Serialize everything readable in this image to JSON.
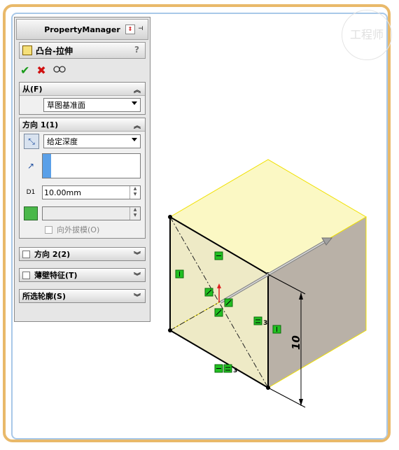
{
  "watermark": "工程师",
  "pm": {
    "header_title": "PropertyManager",
    "feature_title": "凸台-拉伸",
    "help": "?",
    "actions": {
      "ok": "✔",
      "cancel": "✖",
      "preview": "6਼"
    },
    "from": {
      "title": "从(F)",
      "value": "草图基准面"
    },
    "direction1": {
      "title": "方向 1(1)",
      "end_condition": "给定深度",
      "depth": "10.00mm",
      "draft_label": "向外拔模(O)"
    },
    "direction2": {
      "title": "方向 2(2)"
    },
    "thin": {
      "title": "薄壁特征(T)"
    },
    "contours": {
      "title": "所选轮廓(S)"
    }
  },
  "model": {
    "dimension_value": "10",
    "relation_label_a": "3",
    "relation_label_b": "3",
    "colors": {
      "top_face": "#fbf8c4",
      "front_face": "#eeeac6",
      "side_face": "#b9b1a7",
      "edge_highlight": "#f0e000"
    }
  }
}
